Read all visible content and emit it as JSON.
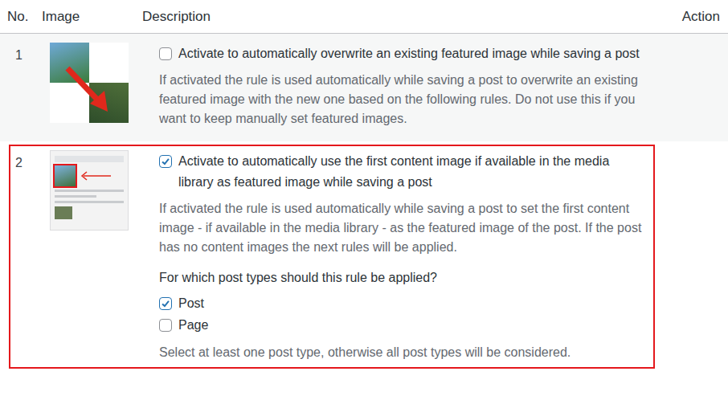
{
  "table": {
    "columns": [
      {
        "label": "No."
      },
      {
        "label": "Image"
      },
      {
        "label": "Description"
      },
      {
        "label": "Action"
      }
    ],
    "rows": [
      {
        "number": "1",
        "highlighted": false,
        "kind": "overwrite",
        "checkbox": {
          "label": "Activate to automatically overwrite an existing featured image while saving a post",
          "checked": false
        },
        "description": "If activated the rule is used automatically while saving a post to overwrite an existing featured image with the new one based on the following rules. Do not use this if you want to keep manually set featured images."
      },
      {
        "number": "2",
        "highlighted": true,
        "kind": "first-image",
        "checkbox": {
          "label": "Activate to automatically use the first content image if available in the media library as featured image while saving a post",
          "checked": true
        },
        "description": "If activated the rule is used automatically while saving a post to set the first content image - if available in the media library - as the featured image of the post. If the post has no content images the next rules will be applied.",
        "question": "For which post types should this rule be applied?",
        "post_types": [
          {
            "label": "Post",
            "checked": true
          },
          {
            "label": "Page",
            "checked": false
          }
        ],
        "hint": "Select at least one post type, otherwise all post types will be considered."
      }
    ]
  }
}
